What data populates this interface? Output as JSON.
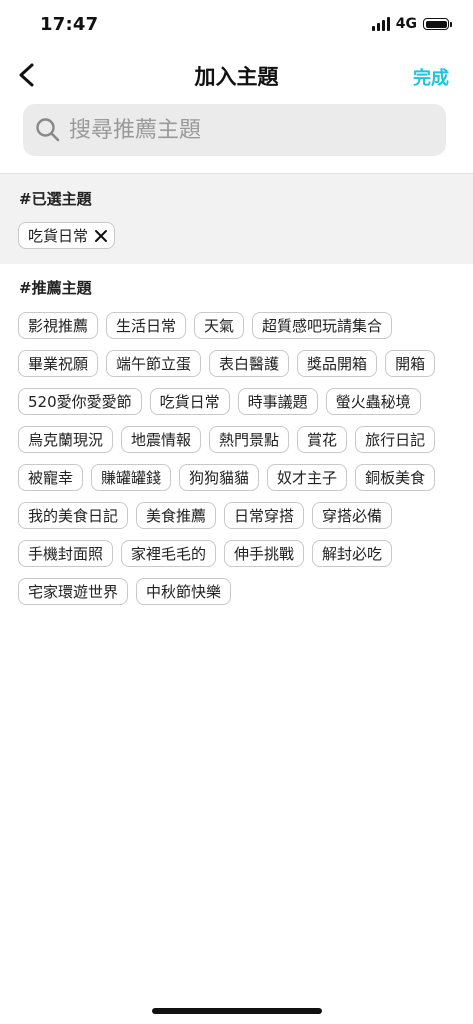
{
  "status_bar": {
    "time": "17:47",
    "network": "4G",
    "icons": [
      "signal-icon",
      "battery-icon"
    ]
  },
  "nav": {
    "back_icon": "chevron-left-icon",
    "title": "加入主題",
    "done_label": "完成"
  },
  "colors": {
    "accent": "#1fc3dc",
    "selected_bg": "#f2f2f2",
    "search_bg": "#ebebeb"
  },
  "search": {
    "icon": "search-icon",
    "placeholder": "搜尋推薦主題",
    "value": ""
  },
  "selected": {
    "heading": "#已選主題",
    "tags": [
      {
        "label": "吃貨日常",
        "remove_icon": "close-icon"
      }
    ]
  },
  "recommended": {
    "heading": "#推薦主題",
    "tags": [
      "影視推薦",
      "生活日常",
      "天氣",
      "超質感吧玩請集合",
      "畢業祝願",
      "端午節立蛋",
      "表白醫護",
      "獎品開箱",
      "開箱",
      "520愛你愛愛節",
      "吃貨日常",
      "時事議題",
      "螢火蟲秘境",
      "烏克蘭現況",
      "地震情報",
      "熱門景點",
      "賞花",
      "旅行日記",
      "被寵幸",
      "賺罐罐錢",
      "狗狗貓貓",
      "奴才主子",
      "銅板美食",
      "我的美食日記",
      "美食推薦",
      "日常穿搭",
      "穿搭必備",
      "手機封面照",
      "家裡毛毛的",
      "伸手挑戰",
      "解封必吃",
      "宅家環遊世界",
      "中秋節快樂"
    ]
  }
}
